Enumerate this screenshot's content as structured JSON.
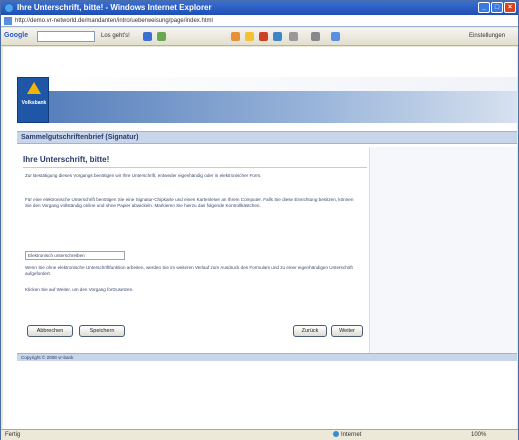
{
  "browser": {
    "title": "Ihre Unterschrift, bitte! - Windows Internet Explorer",
    "address": "http://demo.vr-networld.de/mandanten/intro/ueberweisung/page/index.html"
  },
  "toolbar": {
    "google_label": "Google",
    "go_label": "Los geht's!",
    "bookmarks_label": "Bookmarks",
    "settings_label": "Einstellungen"
  },
  "logo": {
    "text": "Volksbank"
  },
  "section": {
    "title": "Sammelgutschriftenbrief (Signatur)"
  },
  "content": {
    "heading": "Ihre Unterschrift, bitte!",
    "para1": "Zur Bestätigung dieses Vorgangs benötigen wir Ihre Unterschrift, entweder eigenhändig oder in elektronischer Form.",
    "para2": "Für eine elektronische Unterschrift benötigen Sie eine Signatur-Chipkarte und einen Kartenleser an Ihrem Computer. Falls Sie diese Einrichtung besitzen, können Sie den Vorgang vollständig online und ohne Papier abwickeln. Markieren Sie hierzu das folgende Kontrollkästchen.",
    "checkbox_label": "Elektronisch unterschreiben",
    "para3": "Wenn Sie ohne elektronische Unterschriftfunktion arbeiten, werden Sie im weiteren Verlauf zum Ausdruck des Formulars und zu einer eigenhändigen Unterschrift aufgefordert.",
    "para4": "Klicken Sie auf Weiter, um den Vorgang fortzusetzen."
  },
  "buttons": {
    "abbrechen": "Abbrechen",
    "speichern": "Speichern",
    "zurueck": "Zurück",
    "weiter": "Weiter"
  },
  "footer": {
    "text": "Copyright © 2008 vr-bank"
  },
  "status": {
    "left": "Fertig",
    "zone": "Internet",
    "zoom": "100%"
  }
}
